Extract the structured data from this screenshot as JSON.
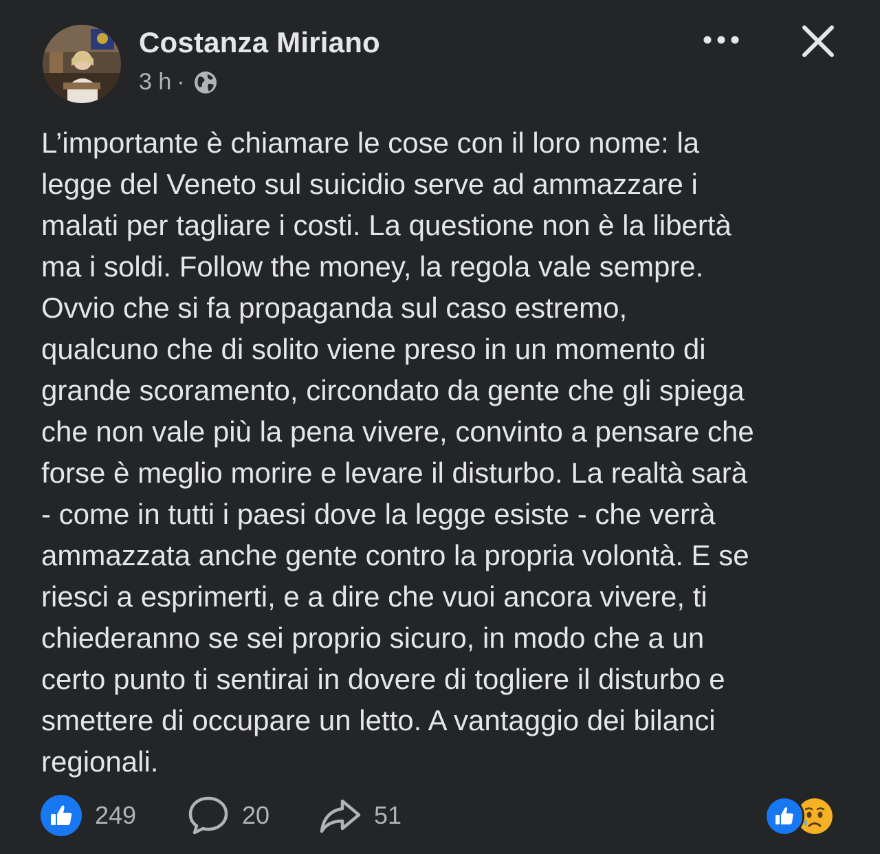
{
  "post": {
    "author": "Costanza Miriano",
    "time": "3 h",
    "separator": "·",
    "audience_icon": "globe-icon",
    "lines": [
      "L’importante è chiamare le cose con il loro nome: la",
      "legge del Veneto sul suicidio serve ad ammazzare i",
      "malati per tagliare i costi. La questione non è la libertà",
      "ma i soldi. Follow the money, la regola vale sempre.",
      "Ovvio che si fa propaganda sul caso estremo,",
      "qualcuno che di solito viene preso in un momento di",
      "grande scoramento, circondato da gente che gli spiega",
      "che non vale più la pena vivere, convinto a pensare che",
      "forse è meglio morire e levare il disturbo. La realtà sarà",
      "- come in tutti i paesi dove la legge esiste - che verrà",
      "ammazzata anche gente contro la propria volontà. E se",
      "riesci a esprimerti, e a dire che vuoi ancora vivere, ti",
      "chiederanno se sei proprio sicuro, in modo che a un",
      "certo punto ti sentirai in dovere di togliere il disturbo e",
      "smettere di occupare un letto. A vantaggio dei bilanci",
      "regionali."
    ]
  },
  "actions": {
    "likes": "249",
    "comments": "20",
    "shares": "51"
  },
  "colors": {
    "background": "#242526",
    "text": "#e4e6eb",
    "secondary_text": "#b0b3b8",
    "like_blue": "#1877f2",
    "sad_yellow": "#f7b125"
  }
}
